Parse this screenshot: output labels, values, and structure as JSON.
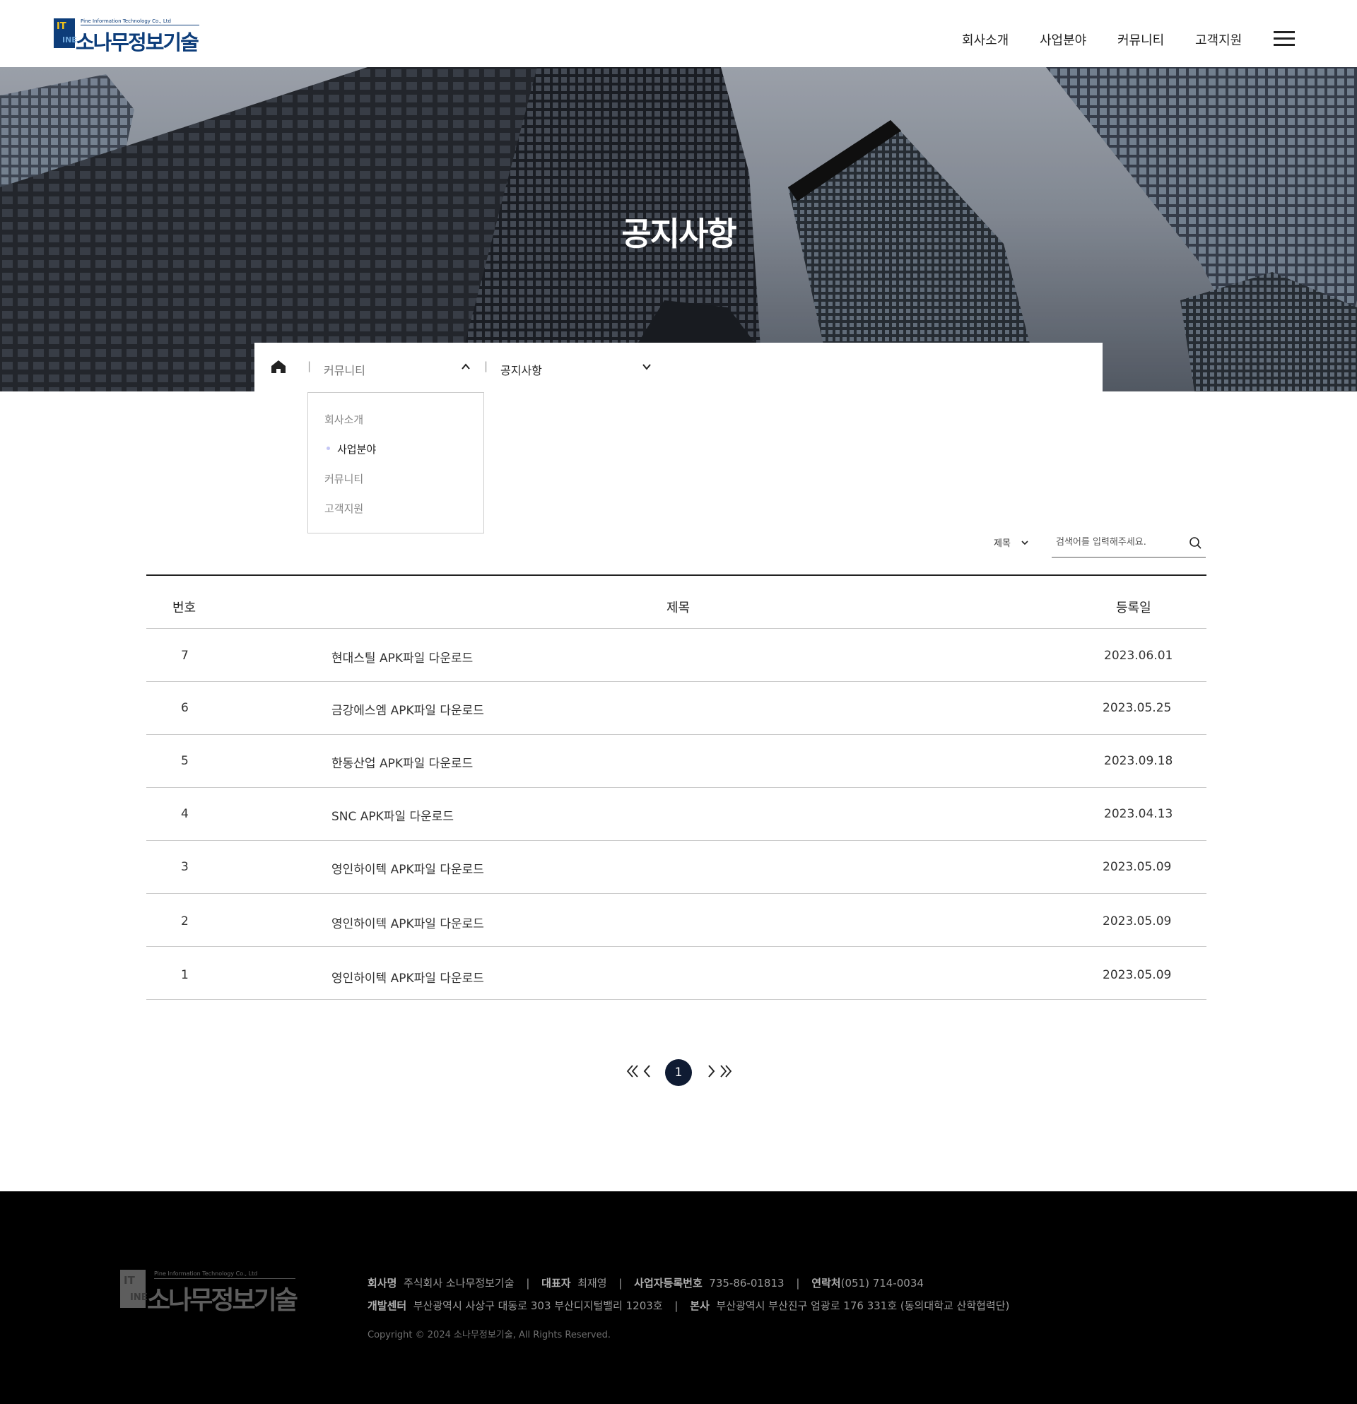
{
  "header": {
    "logo": {
      "mark_top": "IT",
      "mark_bottom": "INE",
      "tagline": "Pine Information Technology Co., Ltd",
      "name": "소나무정보기술"
    },
    "nav": [
      "회사소개",
      "사업분야",
      "커뮤니티",
      "고객지원"
    ],
    "menu_icon": "hamburger-icon"
  },
  "hero": {
    "title": "공지사항"
  },
  "breadcrumb": {
    "home_icon": "home-icon",
    "level1": "커뮤니티",
    "level2": "공지사항"
  },
  "dropdown": {
    "items": [
      "회사소개",
      "사업분야",
      "커뮤니티",
      "고객지원"
    ],
    "active_index": 1
  },
  "search": {
    "field_select": "제목",
    "placeholder": "검색어를 입력해주세요.",
    "icon": "search-icon"
  },
  "table": {
    "headers": {
      "no": "번호",
      "title": "제목",
      "date": "등록일"
    },
    "rows": [
      {
        "no": "7",
        "title": "현대스틸 APK파일 다운로드",
        "date": "2023.06.01"
      },
      {
        "no": "6",
        "title": "금강에스엠 APK파일 다운로드",
        "date": "2023.05.25"
      },
      {
        "no": "5",
        "title": "한동산업 APK파일 다운로드",
        "date": "2023.09.18"
      },
      {
        "no": "4",
        "title": "SNC APK파일 다운로드",
        "date": "2023.04.13"
      },
      {
        "no": "3",
        "title": "영인하이텍 APK파일 다운로드",
        "date": "2023.05.09"
      },
      {
        "no": "2",
        "title": "영인하이텍 APK파일 다운로드",
        "date": "2023.05.09"
      },
      {
        "no": "1",
        "title": "영인하이텍 APK파일 다운로드",
        "date": "2023.05.09"
      }
    ]
  },
  "pagination": {
    "current": "1"
  },
  "footer": {
    "logo": {
      "mark_top": "IT",
      "mark_bottom": "INE",
      "tagline": "Pine Information Technology Co., Ltd",
      "name": "소나무정보기술"
    },
    "company_label": "회사명",
    "company_value": "주식회사 소나무정보기술",
    "ceo_label": "대표자",
    "ceo_value": "최재영",
    "biz_label": "사업자등록번호",
    "biz_value": "735-86-01813",
    "contact_label": "연락처",
    "contact_value": "(051) 714-0034",
    "dev_label": "개발센터",
    "dev_value": "부산광역시 사상구 대동로 303 부산디지털밸리 1203호",
    "hq_label": "본사",
    "hq_value": "부산광역시 부산진구 엄광로 176 331호 (동의대학교 산학협력단)",
    "copyright": "Copyright © 2024 소나무정보기술, All Rights Reserved.",
    "separator": "|"
  },
  "colors": {
    "brand_navy": "#0d3d7a",
    "pagination_active": "#0f1b33",
    "footer_bg": "#000000"
  }
}
